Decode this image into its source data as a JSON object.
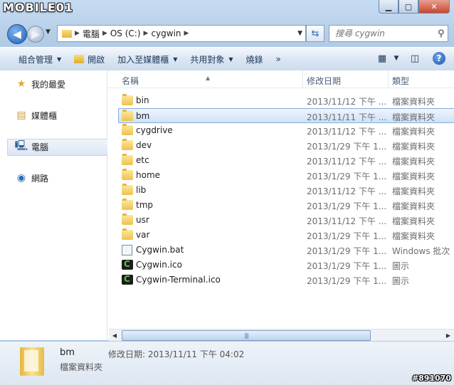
{
  "watermark": "MOBILE01",
  "watermark_id": "#891070",
  "window_controls": {
    "minimize": "▁",
    "maximize": "▢",
    "close": "✕"
  },
  "address": {
    "segments": [
      "電腦",
      "OS (C:)",
      "cygwin"
    ]
  },
  "search": {
    "placeholder": "搜尋 cygwin"
  },
  "toolbar": {
    "organize": "組合管理",
    "open": "開啟",
    "include_in_library": "加入至媒體櫃",
    "share_with": "共用對象",
    "burn": "燒錄",
    "more": "»"
  },
  "nav": {
    "favorites": "我的最愛",
    "libraries": "媒體櫃",
    "computer": "電腦",
    "network": "網路"
  },
  "columns": {
    "name": "名稱",
    "modified": "修改日期",
    "type": "類型"
  },
  "files": [
    {
      "name": "bin",
      "date": "2013/11/12 下午 ...",
      "type": "檔案資料夾",
      "icon": "folder"
    },
    {
      "name": "bm",
      "date": "2013/11/11 下午 ...",
      "type": "檔案資料夾",
      "icon": "folder",
      "selected": true
    },
    {
      "name": "cygdrive",
      "date": "2013/11/12 下午 ...",
      "type": "檔案資料夾",
      "icon": "folder"
    },
    {
      "name": "dev",
      "date": "2013/1/29 下午 1...",
      "type": "檔案資料夾",
      "icon": "folder"
    },
    {
      "name": "etc",
      "date": "2013/11/12 下午 ...",
      "type": "檔案資料夾",
      "icon": "folder"
    },
    {
      "name": "home",
      "date": "2013/1/29 下午 1...",
      "type": "檔案資料夾",
      "icon": "folder"
    },
    {
      "name": "lib",
      "date": "2013/11/12 下午 ...",
      "type": "檔案資料夾",
      "icon": "folder"
    },
    {
      "name": "tmp",
      "date": "2013/1/29 下午 1...",
      "type": "檔案資料夾",
      "icon": "folder"
    },
    {
      "name": "usr",
      "date": "2013/11/12 下午 ...",
      "type": "檔案資料夾",
      "icon": "folder"
    },
    {
      "name": "var",
      "date": "2013/1/29 下午 1...",
      "type": "檔案資料夾",
      "icon": "folder"
    },
    {
      "name": "Cygwin.bat",
      "date": "2013/1/29 下午 1...",
      "type": "Windows 批次",
      "icon": "batch-file"
    },
    {
      "name": "Cygwin.ico",
      "date": "2013/1/29 下午 1...",
      "type": "圖示",
      "icon": "cygwin-ico"
    },
    {
      "name": "Cygwin-Terminal.ico",
      "date": "2013/1/29 下午 1...",
      "type": "圖示",
      "icon": "cygwin-ico"
    }
  ],
  "details": {
    "name": "bm",
    "type": "檔案資料夾",
    "modified": "修改日期: 2013/11/11 下午 04:02"
  }
}
